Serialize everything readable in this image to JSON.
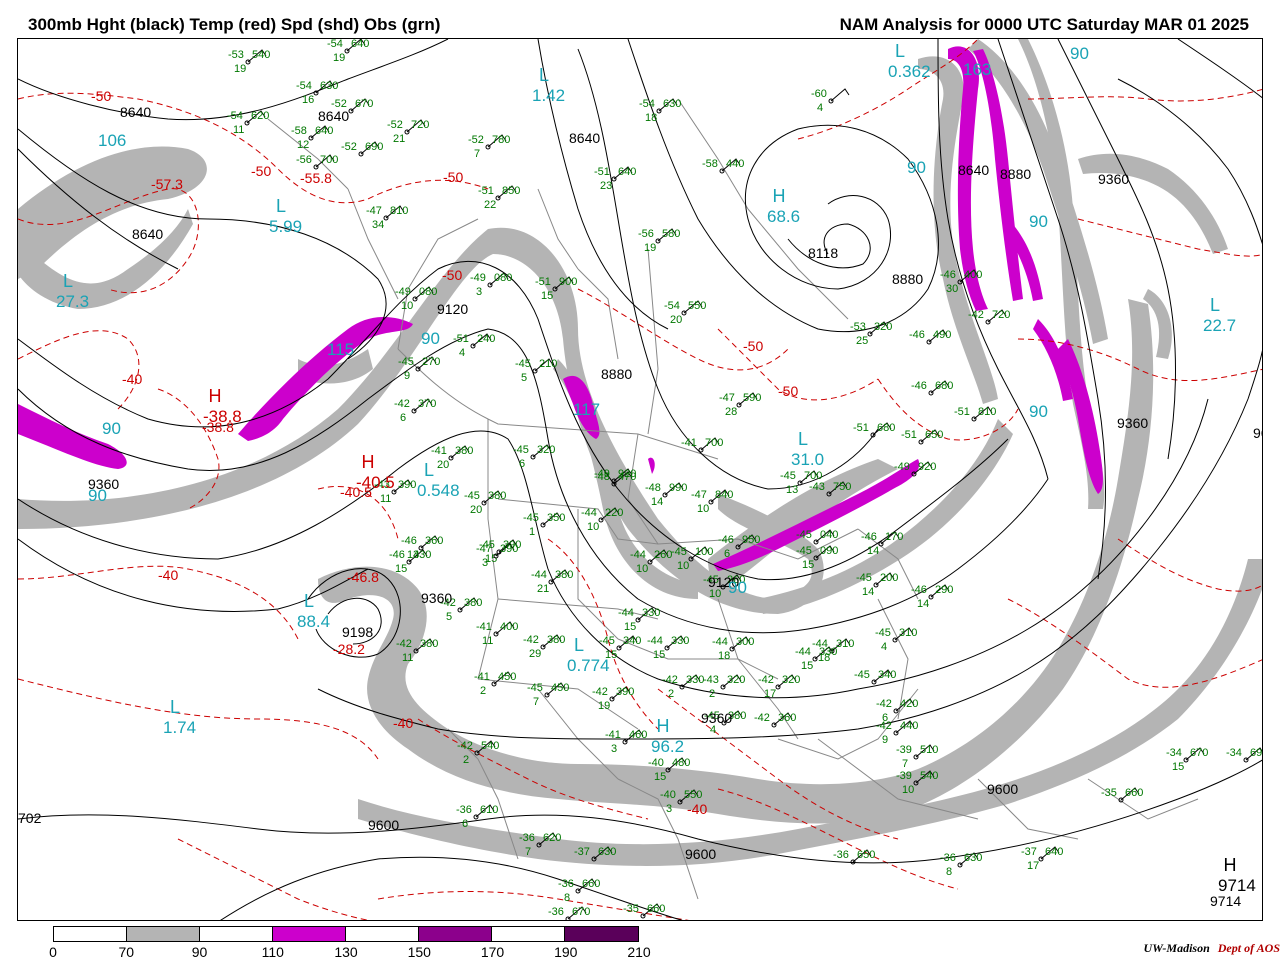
{
  "header": {
    "left_title": "300mb Hght (black) Temp (red) Spd (shd) Obs (grn)",
    "right_title": "NAM Analysis for 0000 UTC Saturday  MAR 01 2025"
  },
  "legend": {
    "ticks": [
      "0",
      "70",
      "90",
      "110",
      "130",
      "150",
      "170",
      "190",
      "210"
    ],
    "colors": [
      "#ffffff",
      "#b4b4b4",
      "#ffffff",
      "#cc00cc",
      "#ffffff",
      "#8c008c",
      "#ffffff",
      "#5a005a"
    ]
  },
  "credit": {
    "org": "UW-Madison",
    "dept": "Dept of AOS"
  },
  "colors": {
    "height_contour": "#000000",
    "temp_contour": "#cc0000",
    "obs": "#007700",
    "speed_label": "#1aa3b5",
    "shade_70": "#b4b4b4",
    "shade_110": "#cc00cc",
    "border_lines": "#888888"
  },
  "height_labels": [
    "8640",
    "8640",
    "8640",
    "8640",
    "8640",
    "8880",
    "8880",
    "8880",
    "9120",
    "9120",
    "9360",
    "9360",
    "9360",
    "9360",
    "9360",
    "9600",
    "9600",
    "9600",
    "9198",
    "9714",
    "8118",
    "96",
    "702"
  ],
  "temp_labels": [
    "-50",
    "-50",
    "-50",
    "-50",
    "-50",
    "-50",
    "-40",
    "-40",
    "-40",
    "-40",
    "-57.3",
    "-55.8",
    "-38.8",
    "-40.5",
    "-46.8",
    "-28.2"
  ],
  "speed_labels": [
    "90",
    "90",
    "90",
    "90",
    "90",
    "90",
    "90",
    "90",
    "106",
    "115",
    "117",
    "163"
  ],
  "pressure_centers": [
    {
      "letter": "L",
      "value": "1.42"
    },
    {
      "letter": "L",
      "value": "5.99"
    },
    {
      "letter": "L",
      "value": "27.3"
    },
    {
      "letter": "L",
      "value": "0.362"
    },
    {
      "letter": "L",
      "value": "22.7"
    },
    {
      "letter": "L",
      "value": "0.548"
    },
    {
      "letter": "L",
      "value": "0.774"
    },
    {
      "letter": "L",
      "value": "1.74"
    },
    {
      "letter": "L",
      "value": "31.0"
    },
    {
      "letter": "L",
      "value": "88.4"
    },
    {
      "letter": "H",
      "value": "68.6"
    },
    {
      "letter": "H",
      "value": "96.2"
    },
    {
      "letter": "H",
      "value": "-38.8"
    },
    {
      "letter": "H",
      "value": "-40.5"
    },
    {
      "letter": "H",
      "value": "9714"
    }
  ],
  "observations": [
    {
      "t": "-53",
      "h": "540",
      "d": "19"
    },
    {
      "t": "-54",
      "h": "640",
      "d": "19"
    },
    {
      "t": "-54",
      "h": "630",
      "d": "16"
    },
    {
      "t": "-54",
      "h": "620",
      "d": "11"
    },
    {
      "t": "-52",
      "h": "670",
      "d": ""
    },
    {
      "t": "-52",
      "h": "720",
      "d": "21"
    },
    {
      "t": "-58",
      "h": "640",
      "d": "12"
    },
    {
      "t": "-52",
      "h": "690",
      "d": ""
    },
    {
      "t": "-52",
      "h": "780",
      "d": "7"
    },
    {
      "t": "-56",
      "h": "700",
      "d": ""
    },
    {
      "t": "-51",
      "h": "850",
      "d": "22"
    },
    {
      "t": "-51",
      "h": "640",
      "d": "23"
    },
    {
      "t": "-54",
      "h": "630",
      "d": "18"
    },
    {
      "t": "-58",
      "h": "440",
      "d": ""
    },
    {
      "t": "-60",
      "h": "",
      "d": "4"
    },
    {
      "t": "-56",
      "h": "580",
      "d": "19"
    },
    {
      "t": "-47",
      "h": "810",
      "d": "34"
    },
    {
      "t": "-49",
      "h": "080",
      "d": "3"
    },
    {
      "t": "-51",
      "h": "900",
      "d": "15"
    },
    {
      "t": "-54",
      "h": "550",
      "d": "20"
    },
    {
      "t": "-49",
      "h": "080",
      "d": "10"
    },
    {
      "t": "-51",
      "h": "240",
      "d": "4"
    },
    {
      "t": "-45",
      "h": "270",
      "d": "9"
    },
    {
      "t": "-45",
      "h": "210",
      "d": "5"
    },
    {
      "t": "-42",
      "h": "370",
      "d": "6"
    },
    {
      "t": "-41",
      "h": "380",
      "d": "20"
    },
    {
      "t": "-43",
      "h": "390",
      "d": "11"
    },
    {
      "t": "-45",
      "h": "380",
      "d": "20"
    },
    {
      "t": "-45",
      "h": "320",
      "d": "6"
    },
    {
      "t": "-47",
      "h": "590",
      "d": "28"
    },
    {
      "t": "-53",
      "h": "320",
      "d": "25"
    },
    {
      "t": "-46",
      "h": "400",
      "d": "30"
    },
    {
      "t": "-42",
      "h": "720",
      "d": ""
    },
    {
      "t": "-46",
      "h": "490",
      "d": ""
    },
    {
      "t": "-46",
      "h": "680",
      "d": ""
    },
    {
      "t": "-51",
      "h": "810",
      "d": ""
    },
    {
      "t": "-51",
      "h": "680",
      "d": ""
    },
    {
      "t": "-51",
      "h": "650",
      "d": ""
    },
    {
      "t": "-49",
      "h": "920",
      "d": ""
    },
    {
      "t": "-45",
      "h": "700",
      "d": "13"
    },
    {
      "t": "-43",
      "h": "750",
      "d": ""
    },
    {
      "t": "-48",
      "h": "990",
      "d": "14"
    },
    {
      "t": "-47",
      "h": "840",
      "d": "10"
    },
    {
      "t": "-41",
      "h": "700",
      "d": ""
    },
    {
      "t": "-49",
      "h": "920",
      "d": ""
    },
    {
      "t": "-46",
      "h": "360",
      "d": "14"
    },
    {
      "t": "-45",
      "h": "390",
      "d": "15"
    },
    {
      "t": "-46",
      "h": "330",
      "d": "15"
    },
    {
      "t": "-45",
      "h": "350",
      "d": "1"
    },
    {
      "t": "-42",
      "h": "380",
      "d": "5"
    },
    {
      "t": "-44",
      "h": "380",
      "d": "21"
    },
    {
      "t": "-41",
      "h": "400",
      "d": "11"
    },
    {
      "t": "-42",
      "h": "380",
      "d": "29"
    },
    {
      "t": "-45",
      "h": "340",
      "d": "15"
    },
    {
      "t": "-44",
      "h": "330",
      "d": "15"
    },
    {
      "t": "-44",
      "h": "300",
      "d": "18"
    },
    {
      "t": "-44",
      "h": "310",
      "d": "18"
    },
    {
      "t": "-44",
      "h": "330",
      "d": "15"
    },
    {
      "t": "-42",
      "h": "330",
      "d": "2"
    },
    {
      "t": "-43",
      "h": "320",
      "d": "2"
    },
    {
      "t": "-42",
      "h": "320",
      "d": "17"
    },
    {
      "t": "-41",
      "h": "450",
      "d": "2"
    },
    {
      "t": "-45",
      "h": "450",
      "d": "7"
    },
    {
      "t": "-42",
      "h": "390",
      "d": "19"
    },
    {
      "t": "-41",
      "h": "460",
      "d": "3"
    },
    {
      "t": "-45",
      "h": "380",
      "d": "4"
    },
    {
      "t": "-42",
      "h": "380",
      "d": "11"
    },
    {
      "t": "-42",
      "h": "360",
      "d": ""
    },
    {
      "t": "-42",
      "h": "420",
      "d": "6"
    },
    {
      "t": "-42",
      "h": "440",
      "d": "9"
    },
    {
      "t": "-39",
      "h": "510",
      "d": "7"
    },
    {
      "t": "-39",
      "h": "540",
      "d": "10"
    },
    {
      "t": "-45",
      "h": "310",
      "d": "4"
    },
    {
      "t": "-45",
      "h": "340",
      "d": ""
    },
    {
      "t": "-45",
      "h": "200",
      "d": "14"
    },
    {
      "t": "-46",
      "h": "290",
      "d": "14"
    },
    {
      "t": "-45",
      "h": "090",
      "d": "15"
    },
    {
      "t": "-46",
      "h": "170",
      "d": "14"
    },
    {
      "t": "-45",
      "h": "040",
      "d": ""
    },
    {
      "t": "-46",
      "h": "950",
      "d": "6"
    },
    {
      "t": "-44",
      "h": "260",
      "d": "10"
    },
    {
      "t": "-44",
      "h": "220",
      "d": "10"
    },
    {
      "t": "-45",
      "h": "260",
      "d": "10"
    },
    {
      "t": "-45",
      "h": "100",
      "d": "10"
    },
    {
      "t": "-44",
      "h": "330",
      "d": "15"
    },
    {
      "t": "-40",
      "h": "480",
      "d": "15"
    },
    {
      "t": "-40",
      "h": "550",
      "d": "3"
    },
    {
      "t": "-42",
      "h": "540",
      "d": "2"
    },
    {
      "t": "-36",
      "h": "610",
      "d": "6"
    },
    {
      "t": "-36",
      "h": "620",
      "d": "7"
    },
    {
      "t": "-37",
      "h": "630",
      "d": ""
    },
    {
      "t": "-36",
      "h": "660",
      "d": "8"
    },
    {
      "t": "-36",
      "h": "670",
      "d": ""
    },
    {
      "t": "-35",
      "h": "660",
      "d": ""
    },
    {
      "t": "-36",
      "h": "650",
      "d": ""
    },
    {
      "t": "-36",
      "h": "630",
      "d": "8"
    },
    {
      "t": "-37",
      "h": "640",
      "d": "17"
    },
    {
      "t": "-35",
      "h": "660",
      "d": ""
    },
    {
      "t": "-34",
      "h": "670",
      "d": "15"
    },
    {
      "t": "-34",
      "h": "690",
      "d": ""
    },
    {
      "t": "-47",
      "h": "390",
      "d": "3"
    },
    {
      "t": "-48",
      "h": "470",
      "d": ""
    }
  ]
}
